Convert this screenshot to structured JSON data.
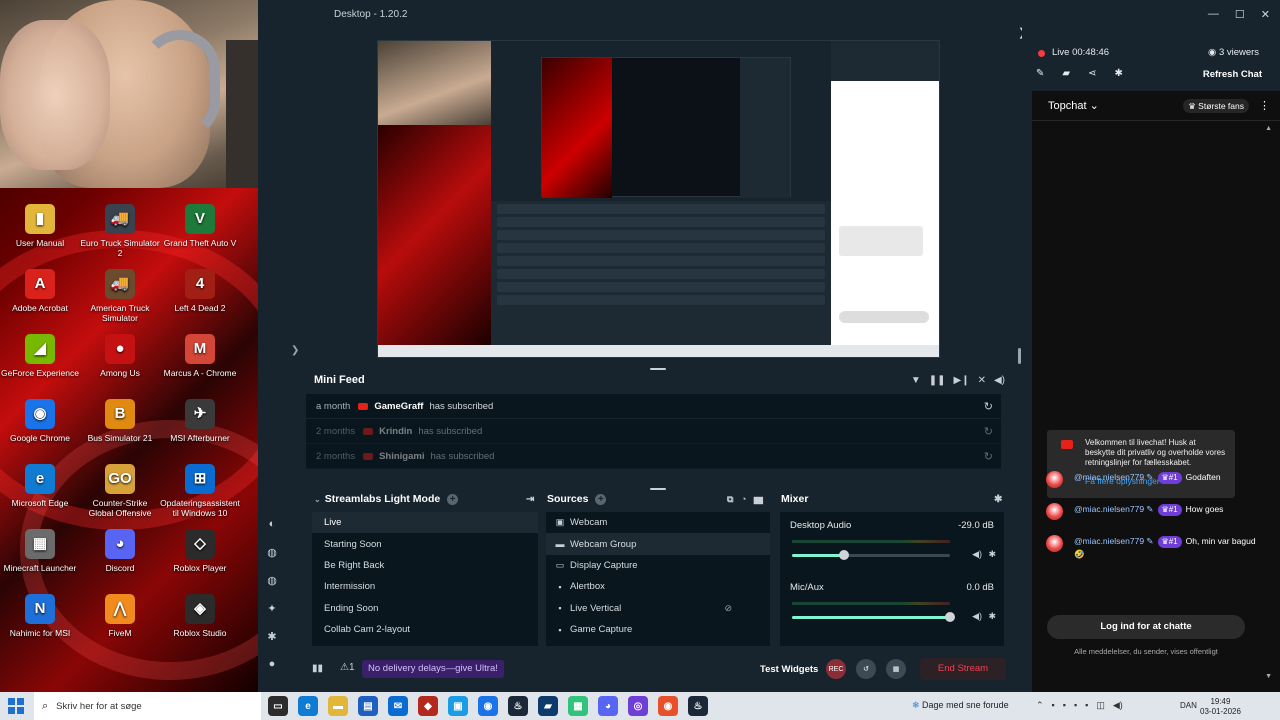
{
  "app": {
    "title": "Desktop - 1.20.2"
  },
  "desktop_icons": [
    {
      "label": "User Manual",
      "color": "#e2b53b",
      "glyph": "▮"
    },
    {
      "label": "Euro Truck Simulator 2",
      "color": "#39424e",
      "glyph": "🚚"
    },
    {
      "label": "Grand Theft Auto V",
      "color": "#1e7a3a",
      "glyph": "V"
    },
    {
      "label": "Adobe Acrobat",
      "color": "#d9221c",
      "glyph": "A"
    },
    {
      "label": "American Truck Simulator",
      "color": "#6b4b2e",
      "glyph": "🚚"
    },
    {
      "label": "Left 4 Dead 2",
      "color": "#a11f14",
      "glyph": "4"
    },
    {
      "label": "GeForce Experience",
      "color": "#76b900",
      "glyph": "◢"
    },
    {
      "label": "Among Us",
      "color": "#c51111",
      "glyph": "●"
    },
    {
      "label": "Marcus A - Chrome",
      "color": "#d44638",
      "glyph": "M"
    },
    {
      "label": "Google Chrome",
      "color": "#1a73e8",
      "glyph": "◉"
    },
    {
      "label": "Bus Simulator 21",
      "color": "#e08a12",
      "glyph": "B"
    },
    {
      "label": "MSI Afterburner",
      "color": "#3a3a3a",
      "glyph": "✈"
    },
    {
      "label": "Microsoft Edge",
      "color": "#0f7bd2",
      "glyph": "e"
    },
    {
      "label": "Counter-Strike Global Offensive",
      "color": "#d8a23a",
      "glyph": "GO"
    },
    {
      "label": "Opdateringsassistent til Windows 10",
      "color": "#0a6cd1",
      "glyph": "⊞"
    },
    {
      "label": "Minecraft Launcher",
      "color": "#6b6b6b",
      "glyph": "▦"
    },
    {
      "label": "Discord",
      "color": "#5865f2",
      "glyph": "◕"
    },
    {
      "label": "Roblox Player",
      "color": "#2b2b2b",
      "glyph": "◇"
    },
    {
      "label": "Nahimic for MSI",
      "color": "#1e6fd8",
      "glyph": "N"
    },
    {
      "label": "FiveM",
      "color": "#f28b1e",
      "glyph": "⋀"
    },
    {
      "label": "Roblox Studio",
      "color": "#2b2b2b",
      "glyph": "◈"
    }
  ],
  "obs_left_icons": [
    "palette-icon",
    "controller-icon",
    "controller-icon",
    "magic-icon",
    "settings-icon",
    "user-icon"
  ],
  "mini_feed": {
    "title": "Mini Feed",
    "rows": [
      {
        "time": "a month",
        "name": "GameGraff",
        "action": "has subscribed"
      },
      {
        "time": "2 months",
        "name": "Krindin",
        "action": "has subscribed"
      },
      {
        "time": "2 months",
        "name": "Shinigami",
        "action": "has subscribed"
      }
    ]
  },
  "scenes": {
    "title": "Streamlabs Light Mode",
    "items": [
      "Live",
      "Starting Soon",
      "Be Right Back",
      "Intermission",
      "Ending Soon",
      "Collab Cam 2-layout"
    ],
    "active": "Live"
  },
  "sources": {
    "title": "Sources",
    "items": [
      {
        "label": "Webcam",
        "icon": "▣"
      },
      {
        "label": "Webcam Group",
        "icon": "▬"
      },
      {
        "label": "Display Capture",
        "icon": "▭"
      },
      {
        "label": "Alertbox",
        "icon": "▪"
      },
      {
        "label": "Live Vertical",
        "icon": "▪"
      },
      {
        "label": "Game Capture",
        "icon": "▪"
      }
    ]
  },
  "mixer": {
    "title": "Mixer",
    "channels": [
      {
        "label": "Desktop Audio",
        "db": "-29.0 dB",
        "level": 0.33
      },
      {
        "label": "Mic/Aux",
        "db": "0.0 dB",
        "level": 1.0
      }
    ]
  },
  "footer": {
    "ultra": "No delivery delays—give Ultra!",
    "test_widgets": "Test Widgets",
    "rec": "REC",
    "end_stream": "End Stream"
  },
  "chat": {
    "live_label": "Live 00:48:46",
    "viewers": "3 viewers",
    "refresh": "Refresh Chat",
    "tab": "Topchat",
    "fans": "Største fans",
    "notice": "Velkommen til livechat! Husk at beskytte dit privatliv og overholde vores retningslinjer for fællesskabet.",
    "notice_link": "Få flere oplysninger",
    "messages": [
      {
        "author": "@miac.nielsen779",
        "badge": "#1",
        "text": "Godaften"
      },
      {
        "author": "@miac.nielsen779",
        "badge": "#1",
        "text": "How goes"
      },
      {
        "author": "@miac.nielsen779",
        "badge": "#1",
        "text": "Oh, min var bagud 🤣"
      }
    ],
    "login": "Log ind for at chatte",
    "public_note": "Alle meddelelser, du sender, vises offentligt"
  },
  "taskbar": {
    "search_placeholder": "Skriv her for at søge",
    "weather": "Dage med sne forude",
    "lang": "DAN",
    "time": "19:49",
    "date": "03-01-2026"
  }
}
